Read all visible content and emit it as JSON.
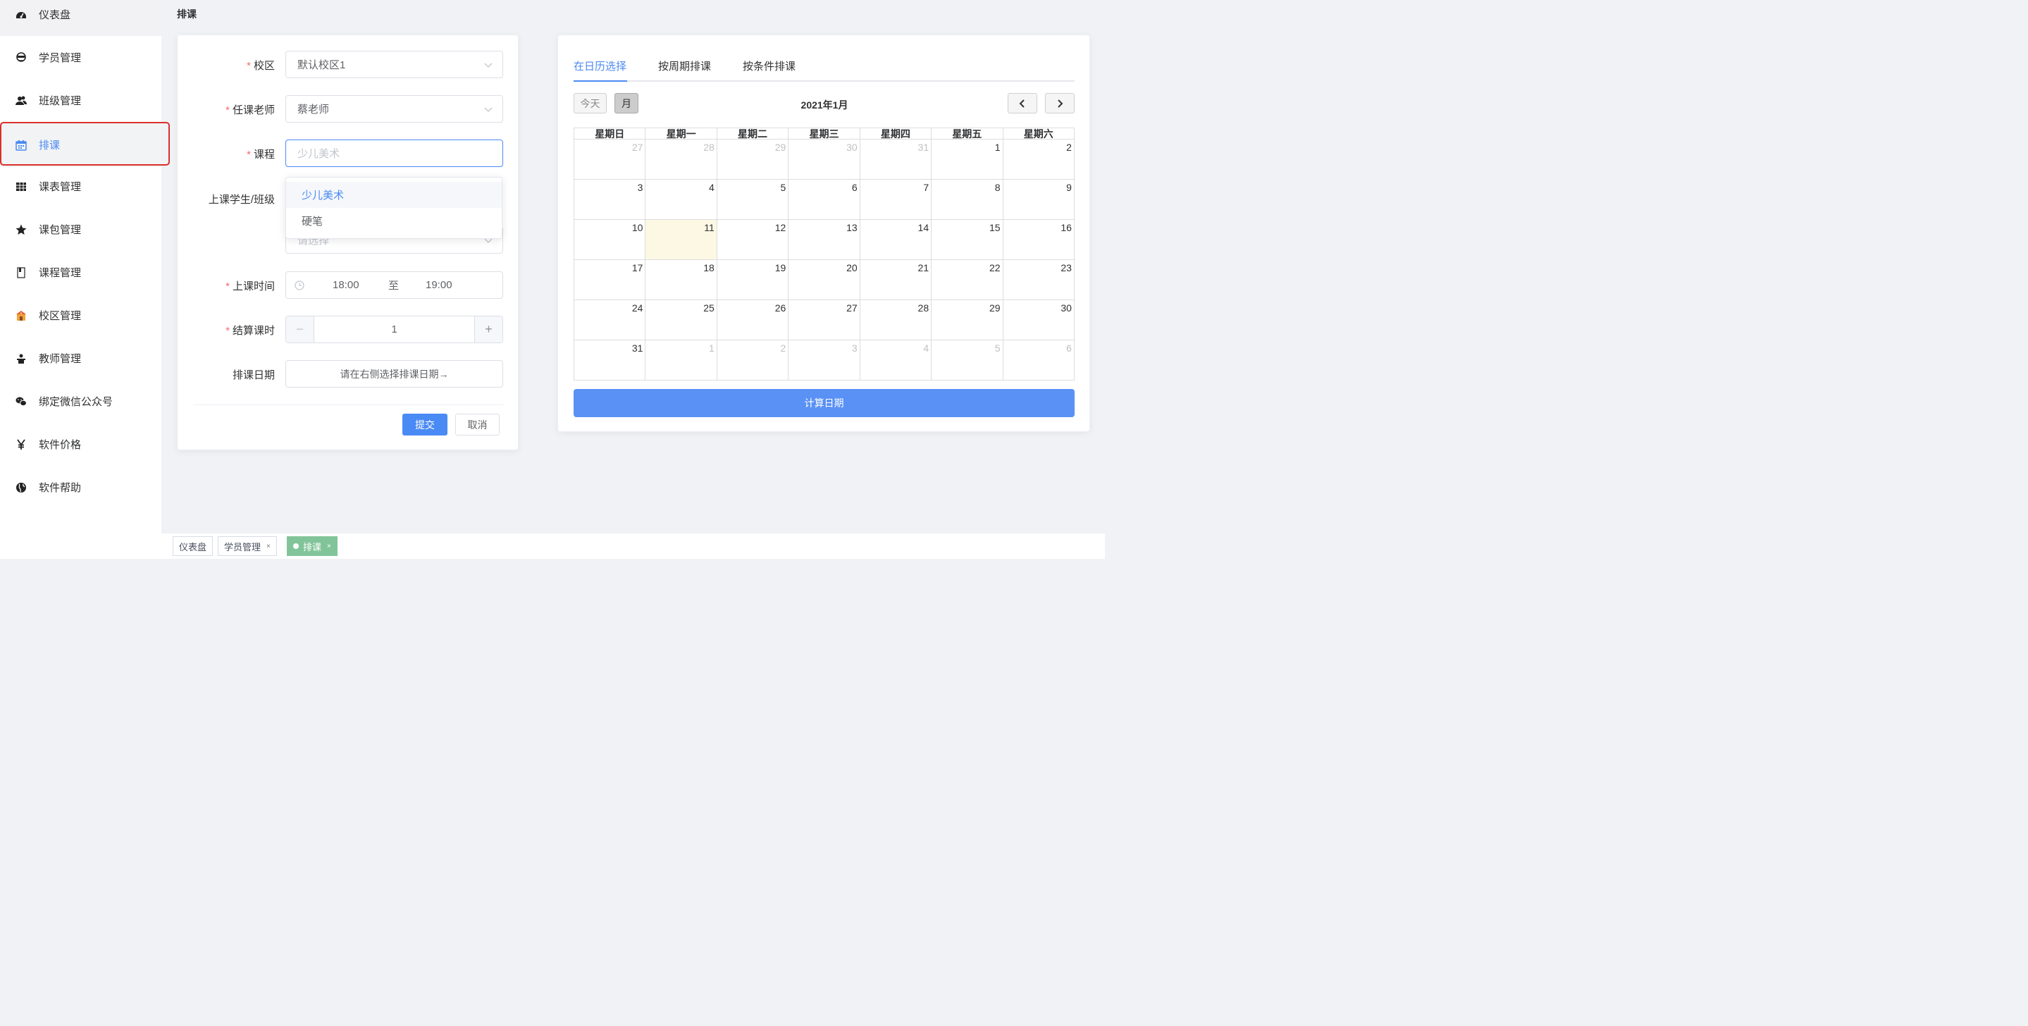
{
  "sidebar": {
    "items": [
      {
        "label": "仪表盘",
        "icon": "dashboard-icon"
      },
      {
        "label": "学员管理",
        "icon": "student-icon"
      },
      {
        "label": "班级管理",
        "icon": "class-icon"
      },
      {
        "label": "排课",
        "icon": "calendar-icon"
      },
      {
        "label": "课表管理",
        "icon": "table-icon"
      },
      {
        "label": "课包管理",
        "icon": "star-icon"
      },
      {
        "label": "课程管理",
        "icon": "book-icon"
      },
      {
        "label": "校区管理",
        "icon": "school-icon"
      },
      {
        "label": "教师管理",
        "icon": "teacher-icon"
      },
      {
        "label": "绑定微信公众号",
        "icon": "wechat-icon"
      },
      {
        "label": "软件价格",
        "icon": "yen-icon"
      },
      {
        "label": "软件帮助",
        "icon": "globe-icon"
      }
    ],
    "active_index": 3
  },
  "header": {
    "title": "排课"
  },
  "form": {
    "campus": {
      "label": "校区",
      "value": "默认校区1"
    },
    "teacher": {
      "label": "任课老师",
      "value": "蔡老师"
    },
    "course": {
      "label": "课程",
      "placeholder": "少儿美术"
    },
    "students": {
      "label": "上课学生/班级",
      "placeholder": "请选择"
    },
    "time": {
      "label": "上课时间",
      "start": "18:00",
      "separator": "至",
      "end": "19:00"
    },
    "hours": {
      "label": "结算课时",
      "value": "1",
      "minus": "−",
      "plus": "+"
    },
    "date": {
      "label": "排课日期",
      "button": "请在右侧选择排课日期→"
    },
    "submit": "提交",
    "cancel": "取消",
    "required_mark": "*"
  },
  "dropdown": {
    "options": [
      "少儿美术",
      "硬笔"
    ],
    "selected": "少儿美术"
  },
  "calendar": {
    "tabs": [
      "在日历选择",
      "按周期排课",
      "按条件排课"
    ],
    "active_tab": "在日历选择",
    "today_button": "今天",
    "month_button": "月",
    "title": "2021年1月",
    "prev": "‹",
    "next": "›",
    "weekdays": [
      "星期日",
      "星期一",
      "星期二",
      "星期三",
      "星期四",
      "星期五",
      "星期六"
    ],
    "weeks": [
      [
        {
          "d": "27",
          "o": true
        },
        {
          "d": "28",
          "o": true
        },
        {
          "d": "29",
          "o": true
        },
        {
          "d": "30",
          "o": true
        },
        {
          "d": "31",
          "o": true
        },
        {
          "d": "1"
        },
        {
          "d": "2"
        }
      ],
      [
        {
          "d": "3"
        },
        {
          "d": "4"
        },
        {
          "d": "5"
        },
        {
          "d": "6"
        },
        {
          "d": "7"
        },
        {
          "d": "8"
        },
        {
          "d": "9"
        }
      ],
      [
        {
          "d": "10"
        },
        {
          "d": "11",
          "today": true
        },
        {
          "d": "12"
        },
        {
          "d": "13"
        },
        {
          "d": "14"
        },
        {
          "d": "15"
        },
        {
          "d": "16"
        }
      ],
      [
        {
          "d": "17"
        },
        {
          "d": "18"
        },
        {
          "d": "19"
        },
        {
          "d": "20"
        },
        {
          "d": "21"
        },
        {
          "d": "22"
        },
        {
          "d": "23"
        }
      ],
      [
        {
          "d": "24"
        },
        {
          "d": "25"
        },
        {
          "d": "26"
        },
        {
          "d": "27"
        },
        {
          "d": "28"
        },
        {
          "d": "29"
        },
        {
          "d": "30"
        }
      ],
      [
        {
          "d": "31"
        },
        {
          "d": "1",
          "o": true
        },
        {
          "d": "2",
          "o": true
        },
        {
          "d": "3",
          "o": true
        },
        {
          "d": "4",
          "o": true
        },
        {
          "d": "5",
          "o": true
        },
        {
          "d": "6",
          "o": true
        }
      ]
    ],
    "calc_button": "计算日期"
  },
  "tags": [
    {
      "label": "仪表盘",
      "closable": false
    },
    {
      "label": "学员管理",
      "closable": true
    },
    {
      "label": "排课",
      "closable": true,
      "active": true
    }
  ],
  "tag_close": "×",
  "colors": {
    "accent": "#4a8af4",
    "required": "#f56c6c",
    "active_tag": "#82c49a",
    "highlight_border": "#d9302a"
  }
}
